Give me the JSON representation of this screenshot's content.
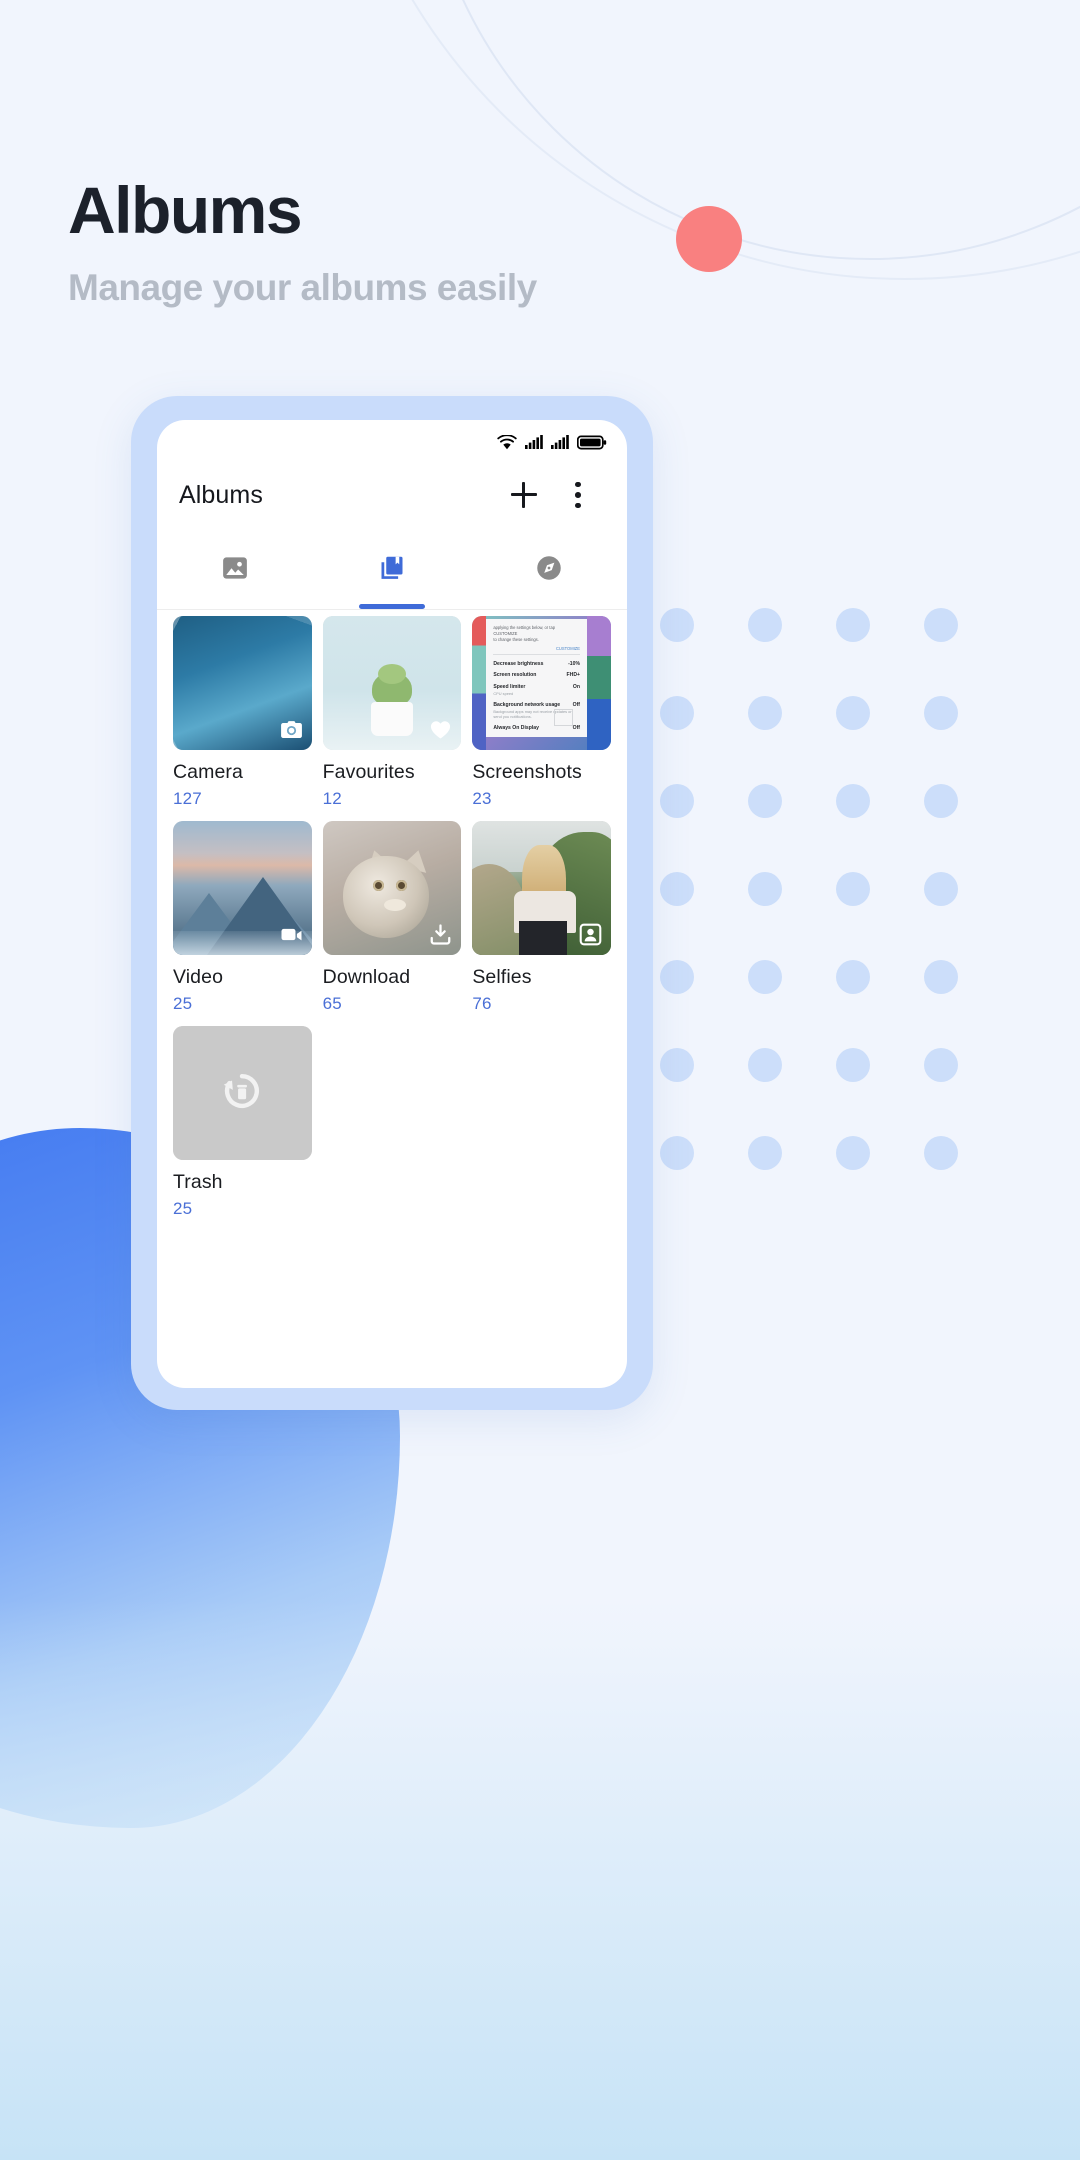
{
  "promo": {
    "title": "Albums",
    "subtitle": "Manage your albums easily"
  },
  "colors": {
    "page_background": "#f1f5fd",
    "title": "#1c212b",
    "subtitle": "#b4bbc6",
    "accent_blue": "#3f6bd8",
    "count_blue": "#4a6fd6",
    "coral_dot": "#f98080",
    "phone_frame": "#c9dcfb",
    "dots": "#ccdefa"
  },
  "phone": {
    "statusbar": {
      "icons": [
        "wifi-icon",
        "signal-sim1-icon",
        "signal-sim2-icon",
        "battery-icon"
      ]
    },
    "appbar": {
      "title": "Albums",
      "add_label": "+",
      "add_icon": "plus-icon",
      "overflow_icon": "kebab-menu-icon"
    },
    "tabs": [
      {
        "name": "photos",
        "icon": "image-icon",
        "active": false
      },
      {
        "name": "albums",
        "icon": "albums-bookmark-icon",
        "active": true
      },
      {
        "name": "explore",
        "icon": "compass-icon",
        "active": false
      }
    ],
    "albums": [
      {
        "name": "Camera",
        "count": "127",
        "badge": "camera-icon",
        "art": "art-ice"
      },
      {
        "name": "Favourites",
        "count": "12",
        "badge": "heart-icon",
        "art": "art-plant"
      },
      {
        "name": "Screenshots",
        "count": "23",
        "badge": "",
        "art": "art-shot"
      },
      {
        "name": "Video",
        "count": "25",
        "badge": "video-icon",
        "art": "art-mtn"
      },
      {
        "name": "Download",
        "count": "65",
        "badge": "download-icon",
        "art": "art-cat"
      },
      {
        "name": "Selfies",
        "count": "76",
        "badge": "portrait-icon",
        "art": "art-selfie"
      },
      {
        "name": "Trash",
        "count": "25",
        "badge": "",
        "art": "art-trash"
      }
    ],
    "screenshot_thumb": {
      "header_line1": "applying the settings below, or tap CUSTOMIZE",
      "header_line2": "to change these settings.",
      "cta": "CUSTOMIZE",
      "rows": [
        {
          "label": "Decrease brightness",
          "sub": "",
          "value": "-10%"
        },
        {
          "label": "Screen resolution",
          "sub": "",
          "value": "FHD+"
        },
        {
          "label": "Speed limiter",
          "sub": "CPU speed",
          "value": "On"
        },
        {
          "label": "Background network usage",
          "sub": "Background apps may not receive updates or send you notifications.",
          "value": "Off"
        },
        {
          "label": "Always On Display",
          "sub": "",
          "value": "Off"
        }
      ]
    }
  }
}
